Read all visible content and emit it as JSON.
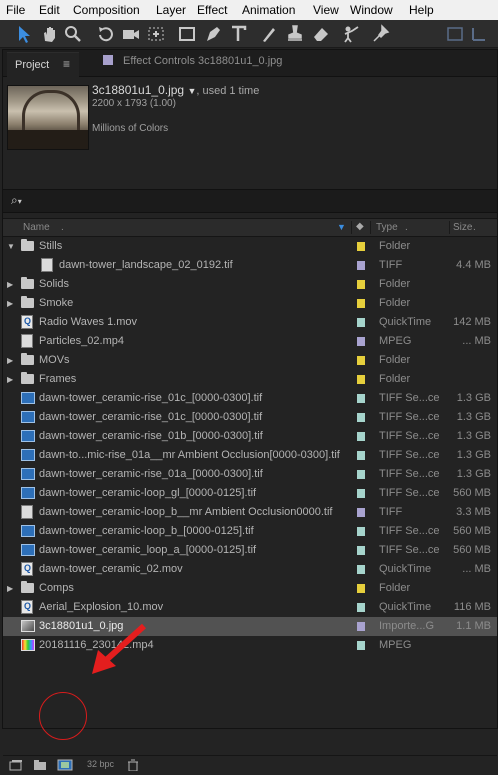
{
  "menubar": [
    "File",
    "Edit",
    "Composition",
    "Layer",
    "Effect",
    "Animation",
    "View",
    "Window",
    "Help"
  ],
  "tabs": {
    "project": "Project",
    "effect_controls": "Effect Controls 3c18801u1_0.jpg"
  },
  "preview": {
    "filename": "3c18801u1_0.jpg",
    "used": ", used 1 time",
    "dimensions": "2200 x 1793 (1.00)",
    "colors": "Millions of Colors"
  },
  "search": {
    "icon": "search-icon"
  },
  "columns": {
    "name": "Name",
    "type": "Type",
    "size": "Size"
  },
  "label_colors": {
    "yellow": "#e6cf3c",
    "lavender": "#a9a3d0",
    "aqua": "#a6d4cc"
  },
  "items": [
    {
      "name": "Stills",
      "type": "Folder",
      "size": "",
      "icon": "folder",
      "indent": 0,
      "expanded": true,
      "label": "yellow"
    },
    {
      "name": "dawn-tower_landscape_02_0192.tif",
      "type": "TIFF",
      "size": "4.4 MB",
      "icon": "file",
      "indent": 1,
      "label": "lavender"
    },
    {
      "name": "Solids",
      "type": "Folder",
      "size": "",
      "icon": "folder",
      "indent": 0,
      "expanded": false,
      "label": "yellow"
    },
    {
      "name": "Smoke",
      "type": "Folder",
      "size": "",
      "icon": "folder",
      "indent": 0,
      "expanded": false,
      "label": "yellow"
    },
    {
      "name": "Radio Waves 1.mov",
      "type": "QuickTime",
      "size": "142 MB",
      "icon": "quicktime",
      "indent": 0,
      "label": "aqua"
    },
    {
      "name": "Particles_02.mp4",
      "type": "MPEG",
      "size": "... MB",
      "icon": "file",
      "indent": 0,
      "label": "lavender"
    },
    {
      "name": "MOVs",
      "type": "Folder",
      "size": "",
      "icon": "folder",
      "indent": 0,
      "expanded": false,
      "label": "yellow"
    },
    {
      "name": "Frames",
      "type": "Folder",
      "size": "",
      "icon": "folder",
      "indent": 0,
      "expanded": false,
      "label": "yellow"
    },
    {
      "name": "dawn-tower_ceramic-rise_01c_[0000-0300].tif",
      "type": "TIFF Se...ce",
      "size": "1.3 GB",
      "icon": "sequence",
      "indent": 0,
      "label": "aqua"
    },
    {
      "name": "dawn-tower_ceramic-rise_01c_[0000-0300].tif",
      "type": "TIFF Se...ce",
      "size": "1.3 GB",
      "icon": "sequence",
      "indent": 0,
      "label": "aqua"
    },
    {
      "name": "dawn-tower_ceramic-rise_01b_[0000-0300].tif",
      "type": "TIFF Se...ce",
      "size": "1.3 GB",
      "icon": "sequence",
      "indent": 0,
      "label": "aqua"
    },
    {
      "name": "dawn-to...mic-rise_01a__mr Ambient Occlusion[0000-0300].tif",
      "type": "TIFF Se...ce",
      "size": "1.3 GB",
      "icon": "sequence",
      "indent": 0,
      "label": "aqua"
    },
    {
      "name": "dawn-tower_ceramic-rise_01a_[0000-0300].tif",
      "type": "TIFF Se...ce",
      "size": "1.3 GB",
      "icon": "sequence",
      "indent": 0,
      "label": "aqua"
    },
    {
      "name": "dawn-tower_ceramic-loop_gl_[0000-0125].tif",
      "type": "TIFF Se...ce",
      "size": "560 MB",
      "icon": "sequence",
      "indent": 0,
      "label": "aqua"
    },
    {
      "name": "dawn-tower_ceramic-loop_b__mr Ambient Occlusion0000.tif",
      "type": "TIFF",
      "size": "3.3 MB",
      "icon": "file",
      "indent": 0,
      "label": "lavender"
    },
    {
      "name": "dawn-tower_ceramic-loop_b_[0000-0125].tif",
      "type": "TIFF Se...ce",
      "size": "560 MB",
      "icon": "sequence",
      "indent": 0,
      "label": "aqua"
    },
    {
      "name": "dawn-tower_ceramic_loop_a_[0000-0125].tif",
      "type": "TIFF Se...ce",
      "size": "560 MB",
      "icon": "sequence",
      "indent": 0,
      "label": "aqua"
    },
    {
      "name": "dawn-tower_ceramic_02.mov",
      "type": "QuickTime",
      "size": "... MB",
      "icon": "quicktime",
      "indent": 0,
      "label": "aqua"
    },
    {
      "name": "Comps",
      "type": "Folder",
      "size": "",
      "icon": "folder",
      "indent": 0,
      "expanded": false,
      "label": "yellow"
    },
    {
      "name": "Aerial_Explosion_10.mov",
      "type": "QuickTime",
      "size": "116 MB",
      "icon": "quicktime",
      "indent": 0,
      "label": "aqua"
    },
    {
      "name": "3c18801u1_0.jpg",
      "type": "Importe...G",
      "size": "1.1 MB",
      "icon": "image",
      "indent": 0,
      "label": "lavender",
      "selected": true
    },
    {
      "name": "20181116_230142.mp4",
      "type": "MPEG",
      "size": "",
      "icon": "video",
      "indent": 0,
      "label": "aqua"
    }
  ],
  "bottombar": {
    "bpc": "32 bpc"
  }
}
